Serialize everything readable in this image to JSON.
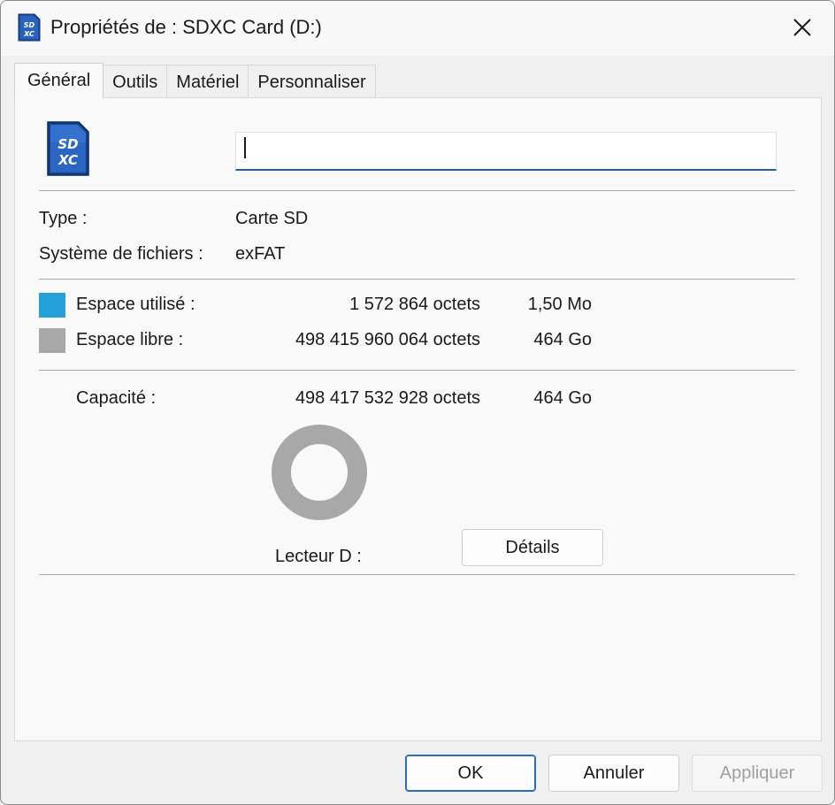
{
  "window": {
    "title": "Propriétés de : SDXC Card (D:)",
    "title_icon": "sdxc-card-icon",
    "close_icon": "close-icon"
  },
  "tabs": [
    {
      "label": "Général",
      "active": true
    },
    {
      "label": "Outils",
      "active": false
    },
    {
      "label": "Matériel",
      "active": false
    },
    {
      "label": "Personnaliser",
      "active": false
    }
  ],
  "general": {
    "drive_icon": "sdxc-card-icon",
    "name_value": "",
    "type_label": "Type :",
    "type_value": "Carte SD",
    "fs_label": "Système de fichiers :",
    "fs_value": "exFAT",
    "used": {
      "label": "Espace utilisé :",
      "bytes": "1 572 864 octets",
      "size": "1,50 Mo",
      "color": "#26a0da"
    },
    "free": {
      "label": "Espace libre :",
      "bytes": "498 415 960 064 octets",
      "size": "464 Go",
      "color": "#a8a8a8"
    },
    "capacity": {
      "label": "Capacité :",
      "bytes": "498 417 532 928 octets",
      "size": "464 Go"
    },
    "drive_label": "Lecteur D :",
    "used_fraction": 3.2e-06,
    "details_button": "Détails"
  },
  "footer": {
    "ok": "OK",
    "cancel": "Annuler",
    "apply": "Appliquer"
  }
}
